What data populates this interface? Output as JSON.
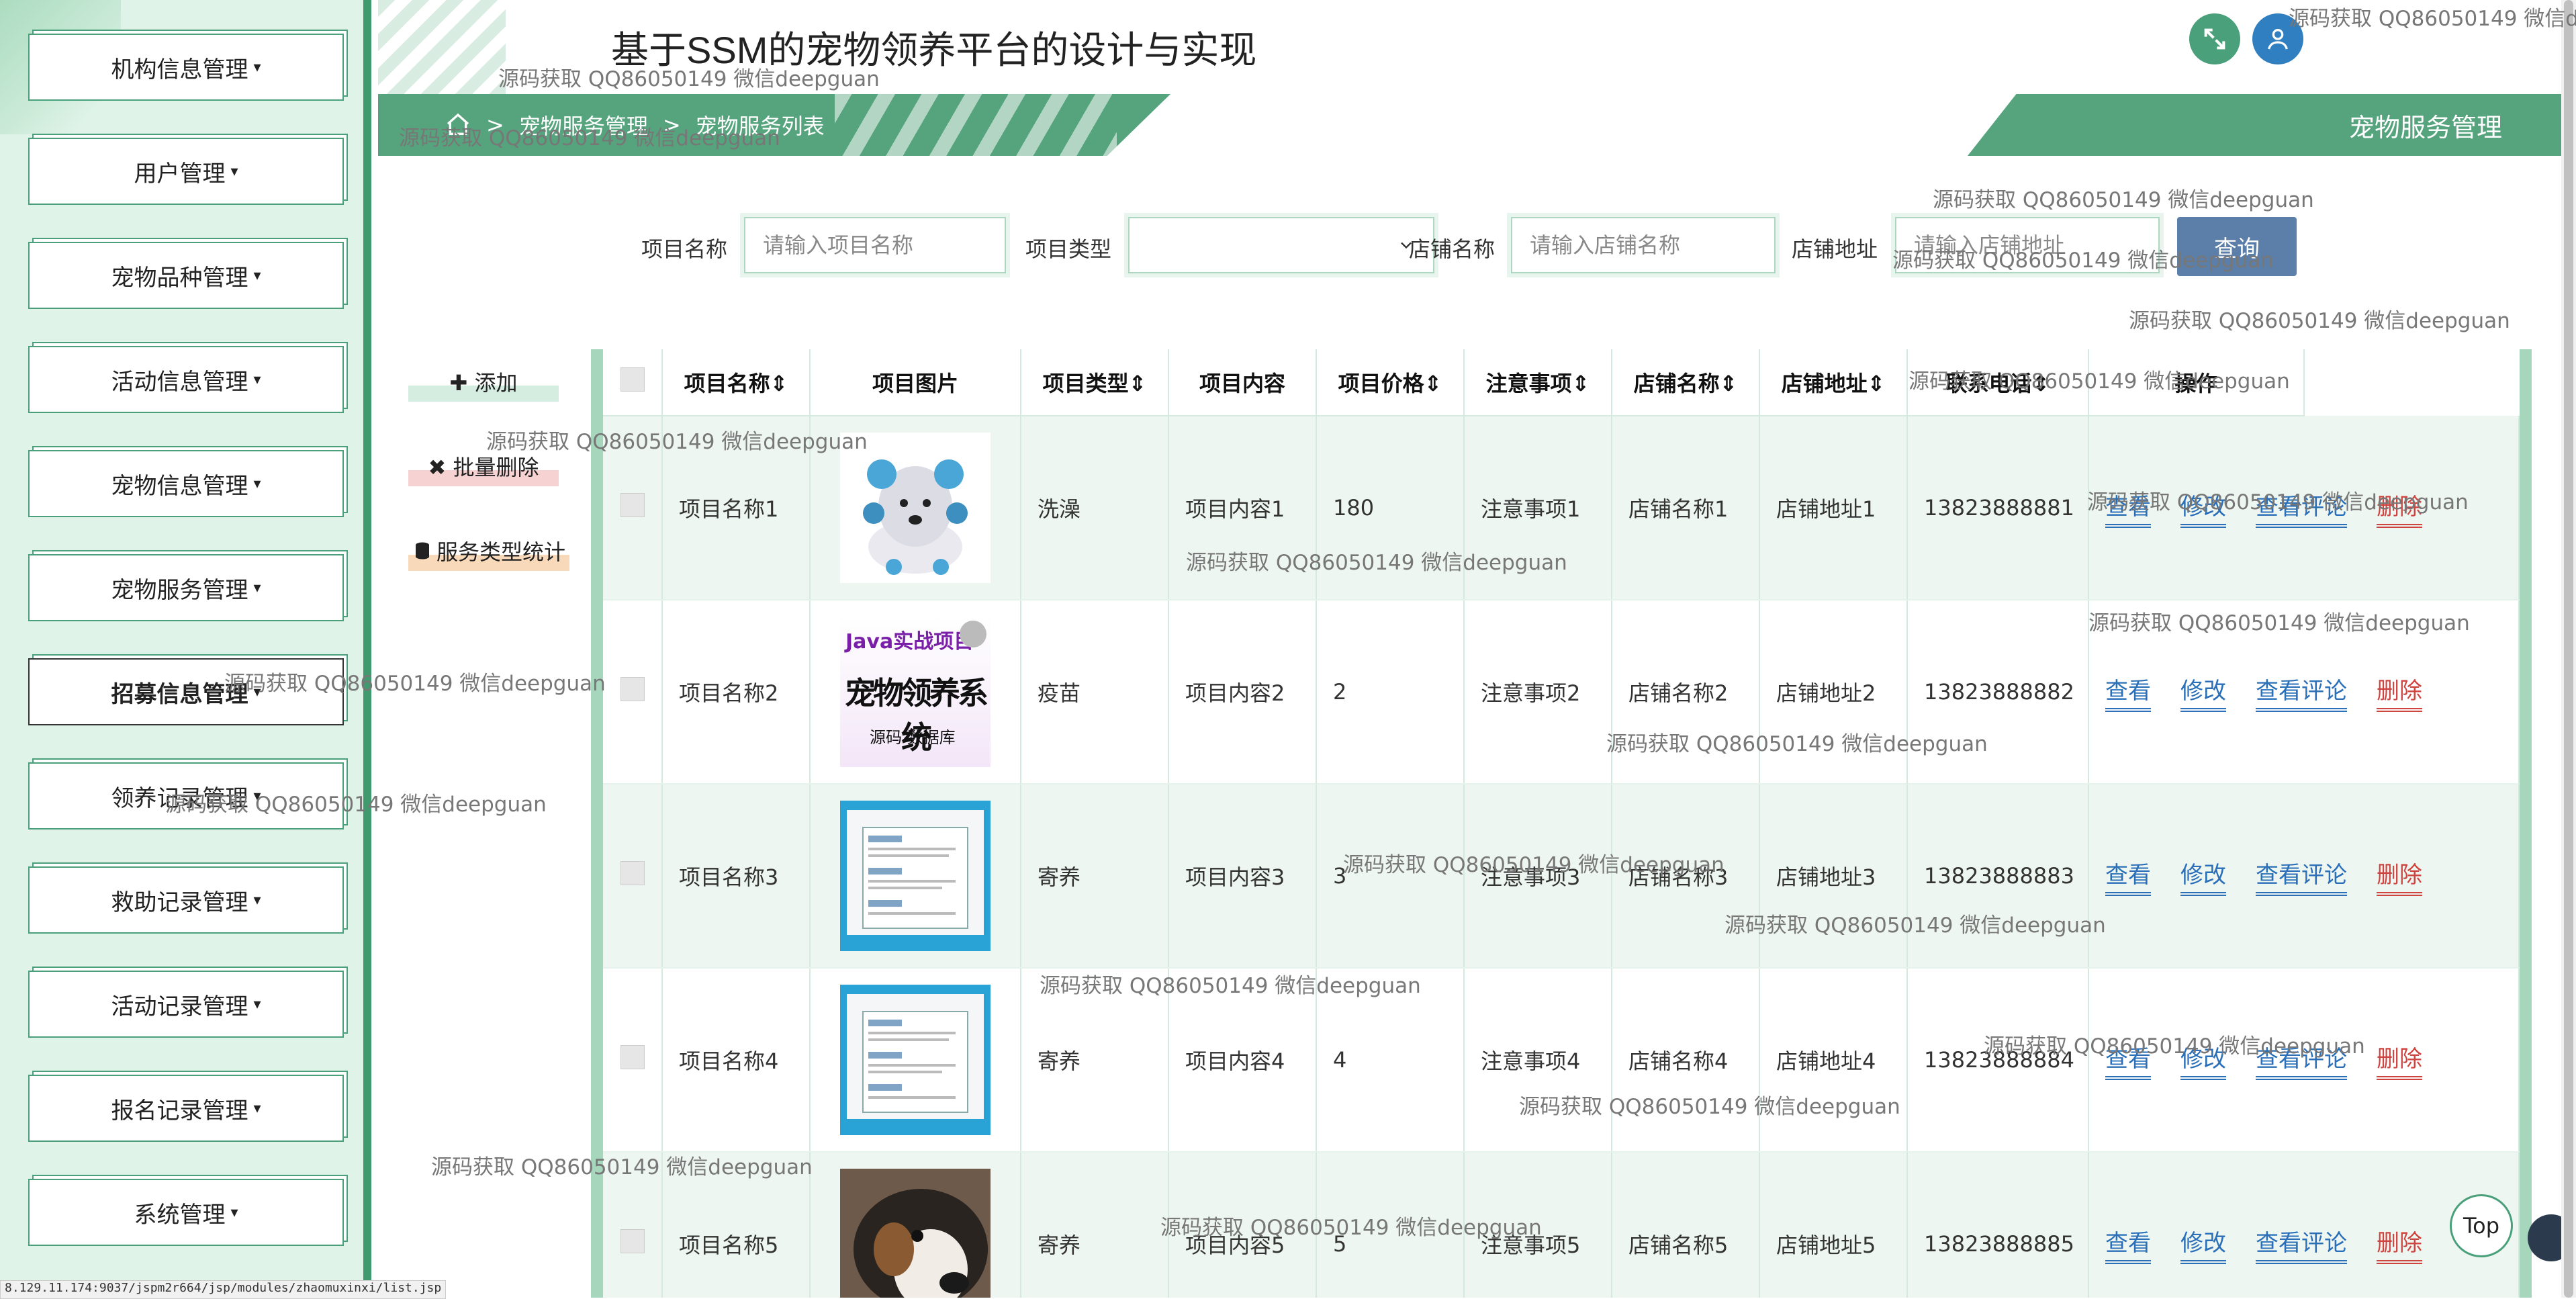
{
  "app": {
    "title": "基于SSM的宠物领养平台的设计与实现"
  },
  "sidebar": {
    "items": [
      {
        "label": "机构信息管理"
      },
      {
        "label": "用户管理"
      },
      {
        "label": "宠物品种管理"
      },
      {
        "label": "活动信息管理"
      },
      {
        "label": "宠物信息管理"
      },
      {
        "label": "宠物服务管理"
      },
      {
        "label": "招募信息管理"
      },
      {
        "label": "领养记录管理"
      },
      {
        "label": "救助记录管理"
      },
      {
        "label": "活动记录管理"
      },
      {
        "label": "报名记录管理"
      },
      {
        "label": "系统管理"
      }
    ],
    "caret": "▾"
  },
  "breadcrumb": {
    "home_icon": "home-icon",
    "separator": ">",
    "level1": "宠物服务管理",
    "level2": "宠物服务列表"
  },
  "page_tag": "宠物服务管理",
  "search": {
    "name_label": "项目名称",
    "name_placeholder": "请输入项目名称",
    "type_label": "项目类型",
    "type_value": "",
    "shop_label": "店铺名称",
    "shop_placeholder": "请输入店铺名称",
    "addr_label": "店铺地址",
    "addr_placeholder": "请输入店铺地址",
    "button": "查询"
  },
  "actions": {
    "add": "✚ 添加",
    "batch_delete": "✖ 批量删除",
    "stats": "服务类型统计"
  },
  "table": {
    "headers": [
      "项目名称⇕",
      "项目图片",
      "项目类型⇕",
      "项目内容",
      "项目价格⇕",
      "注意事项⇕",
      "店铺名称⇕",
      "店铺地址⇕",
      "联系电话⇕",
      "操作"
    ],
    "rows": [
      {
        "name": "项目名称1",
        "type": "洗澡",
        "content": "项目内容1",
        "price": "180",
        "notes": "注意事项1",
        "shop": "店铺名称1",
        "addr": "店铺地址1",
        "phone": "13823888881"
      },
      {
        "name": "项目名称2",
        "type": "疫苗",
        "content": "项目内容2",
        "price": "2",
        "notes": "注意事项2",
        "shop": "店铺名称2",
        "addr": "店铺地址2",
        "phone": "13823888882"
      },
      {
        "name": "项目名称3",
        "type": "寄养",
        "content": "项目内容3",
        "price": "3",
        "notes": "注意事项3",
        "shop": "店铺名称3",
        "addr": "店铺地址3",
        "phone": "13823888883"
      },
      {
        "name": "项目名称4",
        "type": "寄养",
        "content": "项目内容4",
        "price": "4",
        "notes": "注意事项4",
        "shop": "店铺名称4",
        "addr": "店铺地址4",
        "phone": "13823888884"
      },
      {
        "name": "项目名称5",
        "type": "寄养",
        "content": "项目内容5",
        "price": "5",
        "notes": "注意事项5",
        "shop": "店铺名称5",
        "addr": "店铺地址5",
        "phone": "13823888885"
      }
    ],
    "ops": {
      "view": "查看",
      "edit": "修改",
      "comments": "查看评论",
      "delete": "删除"
    }
  },
  "image2_text": {
    "line1": "Java实战项目",
    "line2": "宠物领养系统",
    "line3": "源码 数据库"
  },
  "watermark": "源码获取 QQ86050149 微信deepguan",
  "top_button": "Top",
  "status_url": "8.129.11.174:9037/jspm2r664/jsp/modules/zhaomuxinxi/list.jsp",
  "colors": {
    "accent": "#56a47d",
    "sidebar_bg": "#dff3e8",
    "link": "#2a6fb8",
    "danger": "#d0443f",
    "search_button": "#5b7fa8"
  }
}
